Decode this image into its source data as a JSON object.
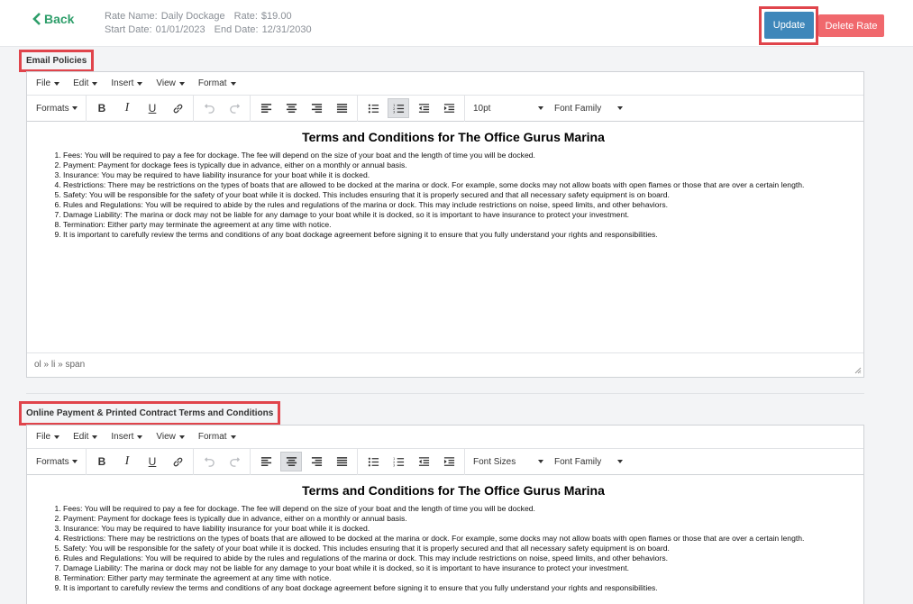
{
  "header": {
    "back_label": "Back",
    "rate_name_label": "Rate Name:",
    "rate_name": "Daily Dockage",
    "rate_label": "Rate:",
    "rate": "$19.00",
    "start_label": "Start Date:",
    "start_date": "01/01/2023",
    "end_label": "End Date:",
    "end_date": "12/31/2030",
    "update_label": "Update",
    "delete_label": "Delete Rate"
  },
  "colors": {
    "accent_green": "#2e9e6a",
    "update_blue": "#3e87ba",
    "delete_red": "#f0686d",
    "highlight_red": "#e0444b"
  },
  "menus": [
    "File",
    "Edit",
    "Insert",
    "View",
    "Format"
  ],
  "toolbar_icons": [
    "bold-icon",
    "italic-icon",
    "underline-icon",
    "link-icon",
    "undo-icon",
    "redo-icon",
    "align-left-icon",
    "align-center-icon",
    "align-right-icon",
    "align-justify-icon",
    "bullet-list-icon",
    "numbered-list-icon",
    "outdent-icon",
    "indent-icon"
  ],
  "editors": [
    {
      "section_title": "Email Policies",
      "formats_label": "Formats",
      "font_size": "10pt",
      "font_family": "Font Family",
      "doc_title": "Terms and Conditions for The Office Gurus Marina",
      "items": [
        "Fees: You will be required to pay a fee for dockage. The fee will depend on the size of your boat and the length of time you will be docked.",
        "Payment: Payment for dockage fees is typically due in advance, either on a monthly or annual basis.",
        "Insurance: You may be required to have liability insurance for your boat while it is docked.",
        "Restrictions: There may be restrictions on the types of boats that are allowed to be docked at the marina or dock. For example, some docks may not allow boats with open flames or those that are over a certain length.",
        "Safety: You will be responsible for the safety of your boat while it is docked. This includes ensuring that it is properly secured and that all necessary safety equipment is on board.",
        "Rules and Regulations: You will be required to abide by the rules and regulations of the marina or dock. This may include restrictions on noise, speed limits, and other behaviors.",
        "Damage Liability: The marina or dock may not be liable for any damage to your boat while it is docked, so it is important to have insurance to protect your investment.",
        "Termination: Either party may terminate the agreement at any time with notice.",
        "It is important to carefully review the terms and conditions of any boat dockage agreement before signing it to ensure that you fully understand your rights and responsibilities."
      ],
      "status_path": "ol » li » span"
    },
    {
      "section_title": "Online Payment & Printed Contract Terms and Conditions",
      "formats_label": "Formats",
      "font_size": "Font Sizes",
      "font_family": "Font Family",
      "doc_title": "Terms and Conditions for The Office Gurus Marina",
      "items": [
        "Fees: You will be required to pay a fee for dockage. The fee will depend on the size of your boat and the length of time you will be docked.",
        "Payment: Payment for dockage fees is typically due in advance, either on a monthly or annual basis.",
        "Insurance: You may be required to have liability insurance for your boat while it is docked.",
        "Restrictions: There may be restrictions on the types of boats that are allowed to be docked at the marina or dock. For example, some docks may not allow boats with open flames or those that are over a certain length.",
        "Safety: You will be responsible for the safety of your boat while it is docked. This includes ensuring that it is properly secured and that all necessary safety equipment is on board.",
        "Rules and Regulations: You will be required to abide by the rules and regulations of the marina or dock. This may include restrictions on noise, speed limits, and other behaviors.",
        "Damage Liability: The marina or dock may not be liable for any damage to your boat while it is docked, so it is important to have insurance to protect your investment.",
        "Termination: Either party may terminate the agreement at any time with notice.",
        "It is important to carefully review the terms and conditions of any boat dockage agreement before signing it to ensure that you fully understand your rights and responsibilities."
      ]
    }
  ]
}
